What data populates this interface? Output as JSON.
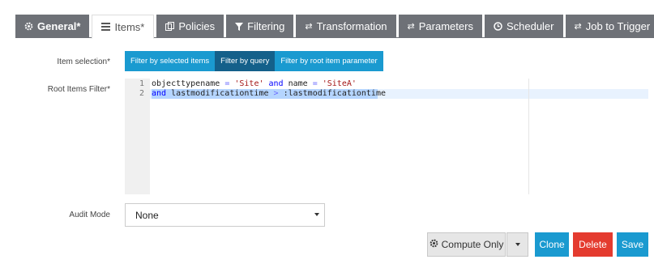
{
  "tabs": [
    {
      "label": "General*",
      "icon": "gear-icon",
      "bold": true,
      "active": false
    },
    {
      "label": "Items*",
      "icon": "list-icon",
      "bold": false,
      "active": true
    },
    {
      "label": "Policies",
      "icon": "policies-icon",
      "bold": false,
      "active": false
    },
    {
      "label": "Filtering",
      "icon": "filter-icon",
      "bold": false,
      "active": false
    },
    {
      "label": "Transformation",
      "icon": "exchange-icon",
      "bold": false,
      "active": false
    },
    {
      "label": "Parameters",
      "icon": "exchange-icon",
      "bold": false,
      "active": false
    },
    {
      "label": "Scheduler",
      "icon": "clock-icon",
      "bold": false,
      "active": false
    },
    {
      "label": "Job to Trigger",
      "icon": "exchange-icon",
      "bold": false,
      "active": false
    }
  ],
  "item_selection": {
    "label": "Item selection*",
    "options": [
      {
        "label": "Filter by selected items",
        "active": false
      },
      {
        "label": "Filter by query",
        "active": true
      },
      {
        "label": "Filter by root item parameter",
        "active": false
      }
    ]
  },
  "root_filter": {
    "label": "Root Items Filter*",
    "line_numbers": [
      "1",
      "2"
    ],
    "line1": {
      "p1": "objecttypename",
      "p2": " = ",
      "p3": "'Site'",
      "p4": " and ",
      "p5": "name",
      "p6": " = ",
      "p7": "'SiteA'"
    },
    "line2": {
      "p1": "and",
      "p2": " lastmodificationtime ",
      "p3": ">",
      "p4": " :lastmodificationtime"
    }
  },
  "audit_mode": {
    "label": "Audit Mode",
    "value": "None"
  },
  "actions": {
    "compute_only": "Compute Only",
    "clone": "Clone",
    "delete": "Delete",
    "save": "Save"
  },
  "colors": {
    "tab_bg": "#6e7177",
    "primary": "#1a9ad0",
    "primary_active": "#14608a",
    "danger": "#e43b2f"
  }
}
